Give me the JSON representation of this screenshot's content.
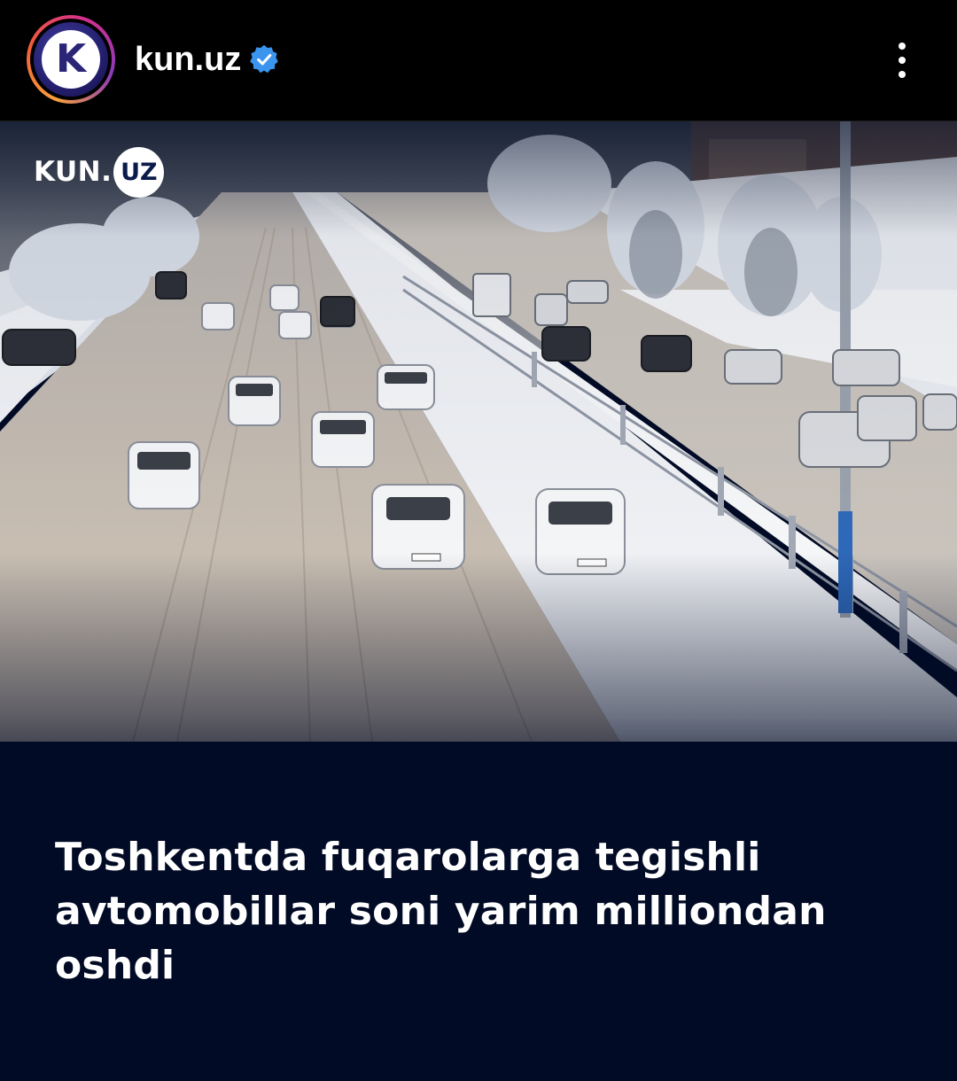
{
  "header": {
    "avatar_letter": "K",
    "username": "kun.uz",
    "verified_icon": "verified-badge-icon",
    "more_icon": "more-vertical-icon"
  },
  "post": {
    "brand_logo": {
      "text": "KUN.",
      "circle_text": "UZ"
    },
    "headline": "Toshkentda fuqarolarga tegishli avtomobillar soni yarim milliondan oshdi",
    "image_description_colors": {
      "overlay": "#020b25",
      "snow": "#e9ecf2",
      "road": "#cbbfb2"
    }
  },
  "colors": {
    "verified": "#3b95ee",
    "header_bg": "#000000",
    "avatar_ring": [
      "#f7a23b",
      "#f15b3a",
      "#d62f8f",
      "#8a3ab9"
    ]
  }
}
